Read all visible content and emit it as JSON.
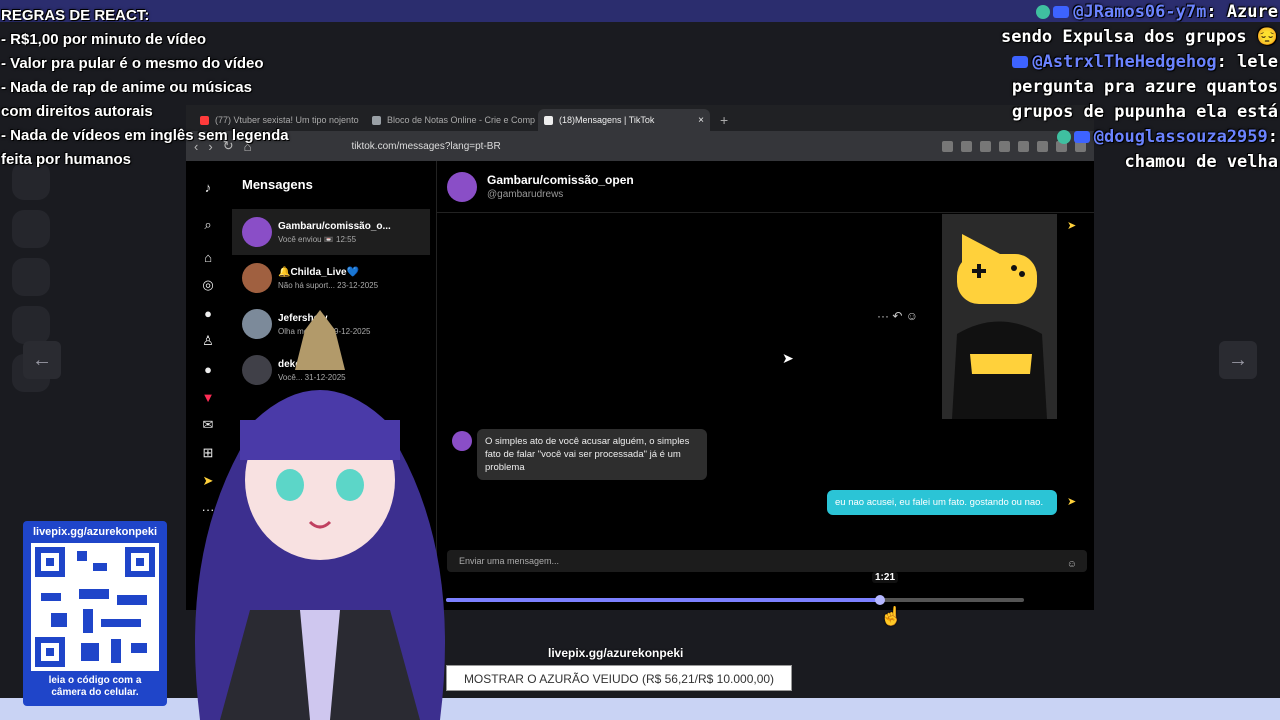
{
  "rules": {
    "title": "REGRAS DE REACT:",
    "lines": [
      "- R$1,00 por minuto de vídeo",
      "- Valor pra pular é o mesmo do vídeo",
      "- Nada de rap de anime ou músicas",
      "com direitos autorais",
      "- Nada de vídeos em inglês sem legenda",
      "feita por humanos"
    ]
  },
  "chat": {
    "msg1_user": "@JRamos06-y7m",
    "msg1_text_a": ": Azure",
    "msg1_text_b": "sendo Expulsa dos grupos 😔",
    "msg2_user": "@AstrxlTheHedgehog",
    "msg2_text_a": ": lele",
    "msg2_text_b": "pergunta pra azure quantos",
    "msg2_text_c": "grupos de pupunha ela está",
    "msg3_user": "@douglassouza2959",
    "msg3_text_a": ":",
    "msg3_text_b": "chamou de velha"
  },
  "browser": {
    "tabs": [
      {
        "label": "(77) Vtuber sexista! Um tipo nojento",
        "color": "#ff3b3b"
      },
      {
        "label": "Bloco de Notas Online - Crie e Comp",
        "color": "#9aa0a6"
      },
      {
        "label": "(18)Mensagens | TikTok",
        "color": "#eee"
      }
    ],
    "tab_close": "×",
    "new_tab": "+",
    "url": "tiktok.com/messages?lang=pt-BR"
  },
  "tiktok": {
    "section_title": "Mensagens",
    "conversations": [
      {
        "name": "Gambaru/comissão_o...",
        "sub": "Você enviou 📼 12:55",
        "color": "#8a4ec7"
      },
      {
        "name": "🔔Childa_Live💙",
        "sub": "Não há suport... 23-12-2025",
        "color": "#a06040"
      },
      {
        "name": "Jefershow",
        "sub": "Olha meu vi... 19-12-2025",
        "color": "#7c8a9a"
      },
      {
        "name": "deko fari",
        "sub": "Você... 31-12-2025",
        "color": "#404048"
      }
    ],
    "header_name": "Gambaru/comissão_open",
    "header_handle": "@gambarudrews",
    "incoming_text": "O simples ato de você acusar alguém, o simples fato de falar \"você vai ser processada\" já é um problema",
    "outgoing_text": "eu nao acusei, eu falei um fato. gostando ou nao.",
    "composer_placeholder": "Enviar uma mensagem...",
    "msg_actions": "··· ↶ ☺"
  },
  "video": {
    "current_time": "1:21",
    "progress_fraction": 0.75
  },
  "qr": {
    "head": "livepix.gg/azurekonpeki",
    "foot_line1": "leia o código com a",
    "foot_line2": "câmera do celular."
  },
  "goal": {
    "url": "livepix.gg/azurekonpeki",
    "label": "MOSTRAR O AZURÃO VEIUDO (R$ 56,21/R$ 10.000,00)"
  },
  "colors": {
    "accent": "#2b2d6e",
    "qr_blue": "#1f45c9",
    "tiktok_bubble": "#2bc4d6",
    "seek_fill": "#7c80ff"
  }
}
